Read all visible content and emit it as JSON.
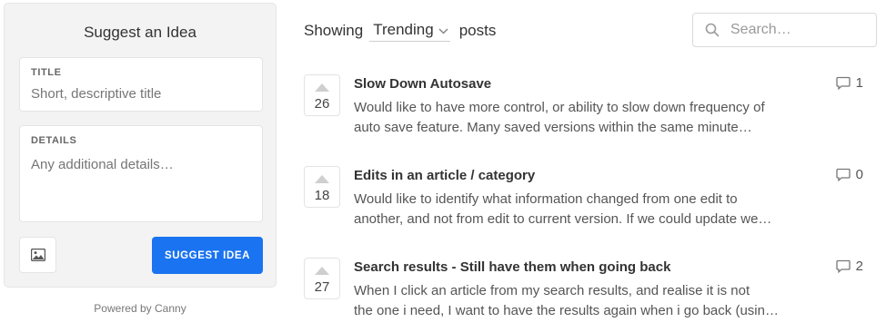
{
  "suggest": {
    "title": "Suggest an Idea",
    "title_field": {
      "label": "TITLE",
      "placeholder": "Short, descriptive title"
    },
    "details_field": {
      "label": "DETAILS",
      "placeholder": "Any additional details…"
    },
    "image_icon": "image-icon",
    "submit_label": "SUGGEST IDEA",
    "powered_by": "Powered by Canny",
    "accent_color": "#1a73f0"
  },
  "header": {
    "showing_label": "Showing",
    "sort_value": "Trending",
    "posts_label": "posts",
    "search_placeholder": "Search…"
  },
  "posts": [
    {
      "votes": "26",
      "title": "Slow Down Autosave",
      "body_line1": "Would like to have more control, or ability to slow down frequency of",
      "body_line2": "auto save feature. Many saved versions within the same minute…",
      "comments": "1"
    },
    {
      "votes": "18",
      "title": "Edits in an article / category",
      "body_line1": "Would like to identify what information changed from one edit to",
      "body_line2": "another, and not from edit to current version. If we could update we…",
      "comments": "0"
    },
    {
      "votes": "27",
      "title": "Search results - Still have them when going back",
      "body_line1": "When I click an article from my search results, and realise it is not",
      "body_line2": "the one i need, I want to have the results again when i go back (usin…",
      "comments": "2"
    }
  ]
}
